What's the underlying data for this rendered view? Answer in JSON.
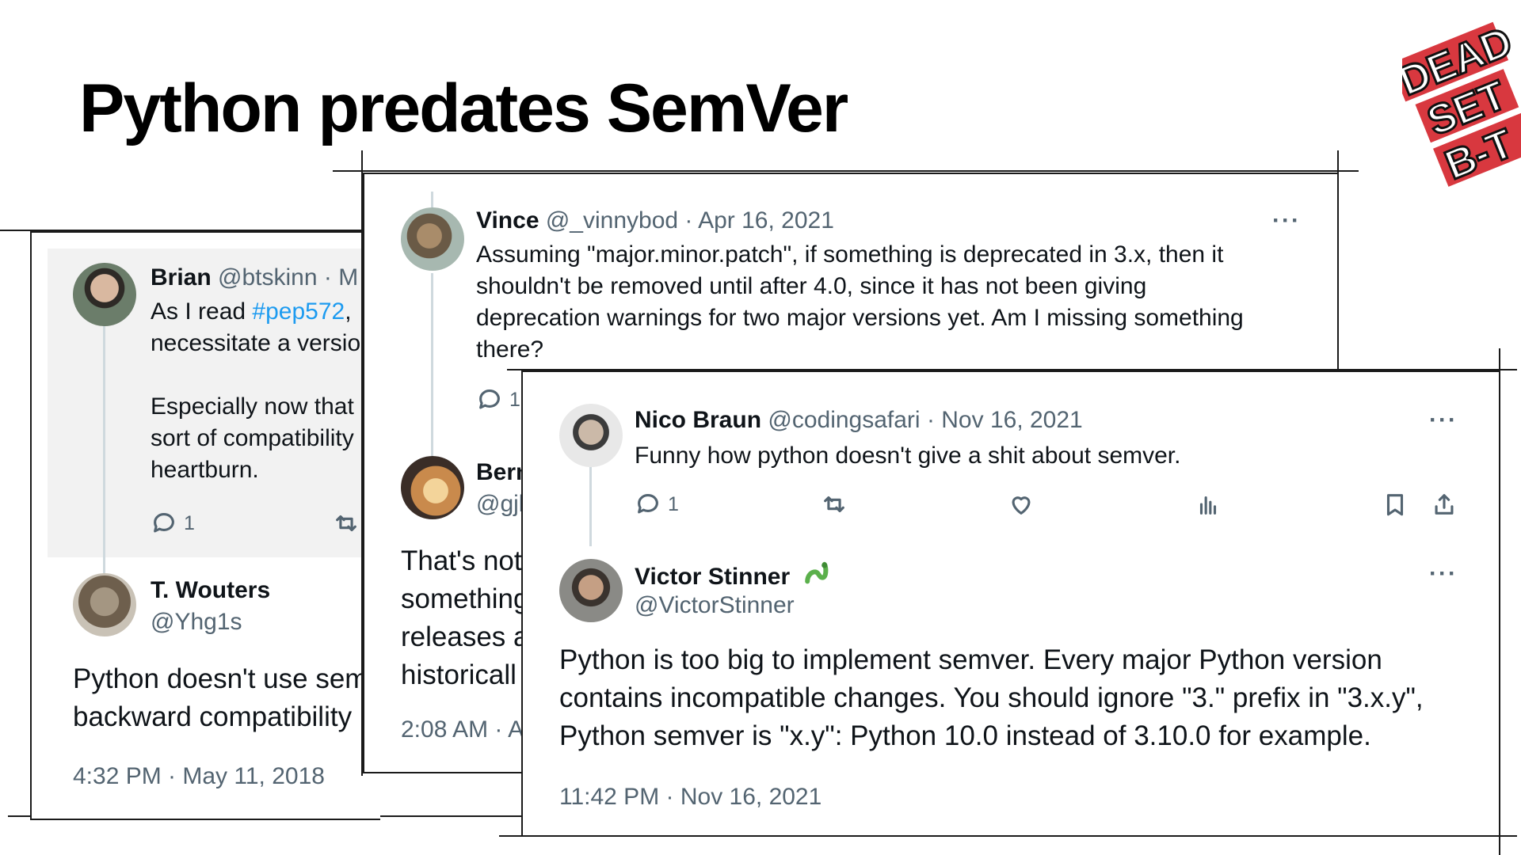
{
  "slide": {
    "title": "Python predates SemVer"
  },
  "logo": {
    "text": "DEAD SET BIT"
  },
  "tweets": {
    "brian": {
      "name": "Brian",
      "handle": "@btskinn",
      "sep": "· M",
      "line1_pre": "As I read ",
      "hashtag": "#pep572",
      "line1_post": ",",
      "line2": "necessitate a versio",
      "line3": "Especially now that",
      "line4": "sort of compatibility",
      "line5": "heartburn.",
      "reply_count": "1"
    },
    "wouters": {
      "name": "T. Wouters",
      "handle": "@Yhg1s",
      "text1": "Python doesn't use sem",
      "text2": "backward compatibility",
      "timestamp": "4:32 PM · May 11, 2018"
    },
    "vince": {
      "name": "Vince",
      "handle": "@_vinnybod",
      "date": "· Apr 16, 2021",
      "lines": [
        "Assuming \"major.minor.patch\", if something is deprecated in 3.x, then it",
        "shouldn't be removed until after 4.0, since it has not been giving",
        "deprecation warnings for two major versions yet. Am I missing something",
        "there?"
      ],
      "reply_count": "1",
      "more": "···"
    },
    "bern": {
      "name": "Bern",
      "handle": "@gjl",
      "text": [
        "That's not",
        "something",
        "releases a",
        "historicall"
      ],
      "timestamp": "2:08 AM · A"
    },
    "nico": {
      "name": "Nico Braun",
      "handle": "@codingsafari",
      "date": "· Nov 16, 2021",
      "text": "Funny how python doesn't give a shit about semver.",
      "reply_count": "1",
      "more": "···"
    },
    "victor": {
      "name": "Victor Stinner",
      "handle": "@VictorStinner",
      "lines": [
        "Python is too big to implement semver. Every major Python version",
        "contains incompatible changes. You should ignore \"3.\" prefix in \"3.x.y\",",
        "Python semver is \"x.y\": Python 10.0 instead of 3.10.0 for example."
      ],
      "timestamp": "11:42 PM · Nov 16, 2021",
      "more": "···"
    }
  },
  "colors": {
    "hashtag": "#1d9bf0",
    "muted": "#536471",
    "text": "#0f1419",
    "thread": "#cfd9de"
  },
  "icons": [
    "reply-icon",
    "retweet-icon",
    "like-icon",
    "views-icon",
    "bookmark-icon",
    "share-icon",
    "snake-emoji-icon"
  ]
}
